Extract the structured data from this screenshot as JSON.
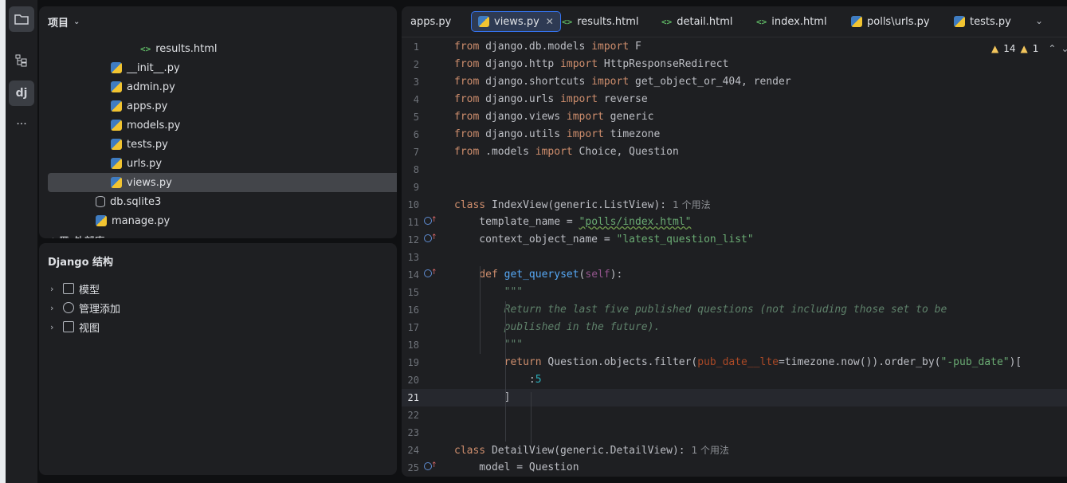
{
  "activity": {
    "icons": [
      "folder-icon",
      "structure-icon",
      "django-icon",
      "more-icon"
    ],
    "more_label": "···",
    "django_label": "dj"
  },
  "project": {
    "title": "项目",
    "files": [
      {
        "name": "results.html",
        "type": "html"
      },
      {
        "name": "__init__.py",
        "type": "py"
      },
      {
        "name": "admin.py",
        "type": "py"
      },
      {
        "name": "apps.py",
        "type": "py"
      },
      {
        "name": "models.py",
        "type": "py"
      },
      {
        "name": "tests.py",
        "type": "py"
      },
      {
        "name": "urls.py",
        "type": "py"
      },
      {
        "name": "views.py",
        "type": "py"
      },
      {
        "name": "db.sqlite3",
        "type": "db"
      },
      {
        "name": "manage.py",
        "type": "py"
      },
      {
        "name": "外部库",
        "type": "lib"
      }
    ]
  },
  "structure": {
    "title": "Django 结构",
    "items": [
      {
        "label": "模型"
      },
      {
        "label": "管理添加"
      },
      {
        "label": "视图"
      }
    ]
  },
  "tabs": [
    {
      "label": "apps.py",
      "type": "py"
    },
    {
      "label": "views.py",
      "type": "py",
      "active": true
    },
    {
      "label": "results.html",
      "type": "html"
    },
    {
      "label": "detail.html",
      "type": "html"
    },
    {
      "label": "index.html",
      "type": "html"
    },
    {
      "label": "polls\\urls.py",
      "type": "py"
    },
    {
      "label": "tests.py",
      "type": "py"
    }
  ],
  "indicators": {
    "warnings": "14",
    "weak_warnings": "1"
  },
  "hints": {
    "usages_10": "1 个用法",
    "usages_24": "1 个用法"
  },
  "code": {
    "l1": [
      "from",
      " django.db.models ",
      "import",
      " F"
    ],
    "l2": [
      "from",
      " django.http ",
      "import",
      " HttpResponseRedirect"
    ],
    "l3": [
      "from",
      " django.shortcuts ",
      "import",
      " get_object_or_404, render"
    ],
    "l4": [
      "from",
      " django.urls ",
      "import",
      " reverse"
    ],
    "l5": [
      "from",
      " django.views ",
      "import",
      " generic"
    ],
    "l6": [
      "from",
      " django.utils ",
      "import",
      " timezone"
    ],
    "l7": [
      "from",
      " .models ",
      "import",
      " Choice, Question"
    ],
    "l10": [
      "class",
      " IndexView(generic.ListView):"
    ],
    "l11": [
      "    template_name = ",
      "\"polls/index.html\""
    ],
    "l12": [
      "    context_object_name = ",
      "\"latest_question_list\""
    ],
    "l14": [
      "    ",
      "def",
      " ",
      "get_queryset",
      "(",
      "self",
      "):"
    ],
    "l15": "        \"\"\"",
    "l16": "        Return the last five published questions (not including those set to be",
    "l17": "        published in the future).",
    "l18": "        \"\"\"",
    "l19": [
      "        ",
      "return",
      " Question.objects.filter(",
      "pub_date__lte",
      "=timezone.now()).order_by(",
      "\"-pub_date\"",
      ")["
    ],
    "l20": [
      "            :",
      "5"
    ],
    "l21": "        ]",
    "l24": [
      "class",
      " DetailView(generic.DetailView):"
    ],
    "l25": "    model = Question"
  }
}
